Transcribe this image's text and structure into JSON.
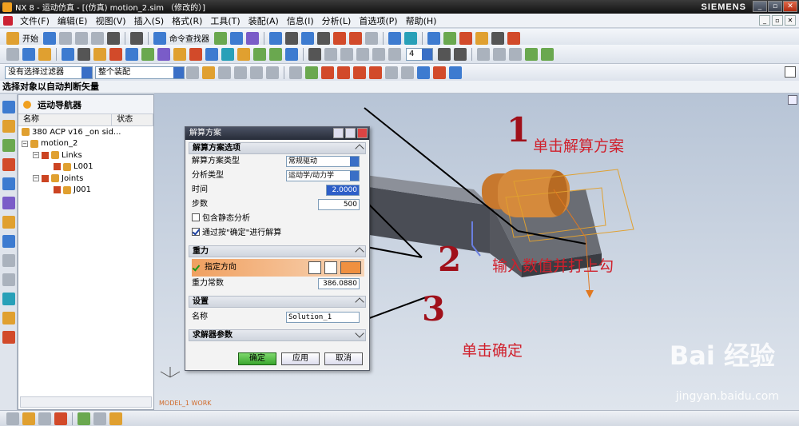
{
  "window": {
    "title": "NX 8 - 运动仿真 - [(仿真) motion_2.sim （修改的）]",
    "brand": "SIEMENS"
  },
  "menu": [
    "文件(F)",
    "编辑(E)",
    "视图(V)",
    "插入(S)",
    "格式(R)",
    "工具(T)",
    "装配(A)",
    "信息(I)",
    "分析(L)",
    "首选项(P)",
    "帮助(H)"
  ],
  "toolbar": {
    "start_label": "开始",
    "command_finder_label": "命令查找器",
    "frame_value": "4"
  },
  "filters": {
    "selection_filter": "没有选择过滤器",
    "assembly_scope": "整个装配"
  },
  "status_hint": "选择对象以自动判断矢量",
  "navigator": {
    "title": "运动导航器",
    "columns": [
      "名称",
      "状态"
    ],
    "nodes": [
      {
        "label": "380 ACP v16 _on sid...",
        "level": 0
      },
      {
        "label": "motion_2",
        "level": 0
      },
      {
        "label": "Links",
        "level": 1
      },
      {
        "label": "L001",
        "level": 2
      },
      {
        "label": "Joints",
        "level": 1
      },
      {
        "label": "J001",
        "level": 2
      }
    ]
  },
  "viewport": {
    "label": "MODEL_1 WORK"
  },
  "dialog": {
    "title": "解算方案",
    "section_solution_options": "解算方案选项",
    "solution_type_label": "解算方案类型",
    "solution_type_value": "常规驱动",
    "analysis_type_label": "分析类型",
    "analysis_type_value": "运动学/动力学",
    "time_label": "时间",
    "time_value": "2.0000",
    "steps_label": "步数",
    "steps_value": "500",
    "static_analysis_label": "包含静态分析",
    "solve_on_ok_label": "通过按\"确定\"进行解算",
    "section_gravity": "重力",
    "specify_direction_label": "指定方向",
    "gravity_constant_label": "重力常数",
    "gravity_constant_value": "386.0880",
    "section_settings": "设置",
    "name_label": "名称",
    "name_value": "Solution_1",
    "section_solver": "求解器参数",
    "ok_label": "确定",
    "apply_label": "应用",
    "cancel_label": "取消"
  },
  "annotations": {
    "step1_num": "1",
    "step1_text": "单击解算方案",
    "step2_num": "2",
    "step2_text": "输入数值并打上勾",
    "step3_num": "3",
    "step3_text": "单击确定"
  },
  "watermark": {
    "brand": "Bai 经验",
    "url": "jingyan.baidu.com"
  }
}
